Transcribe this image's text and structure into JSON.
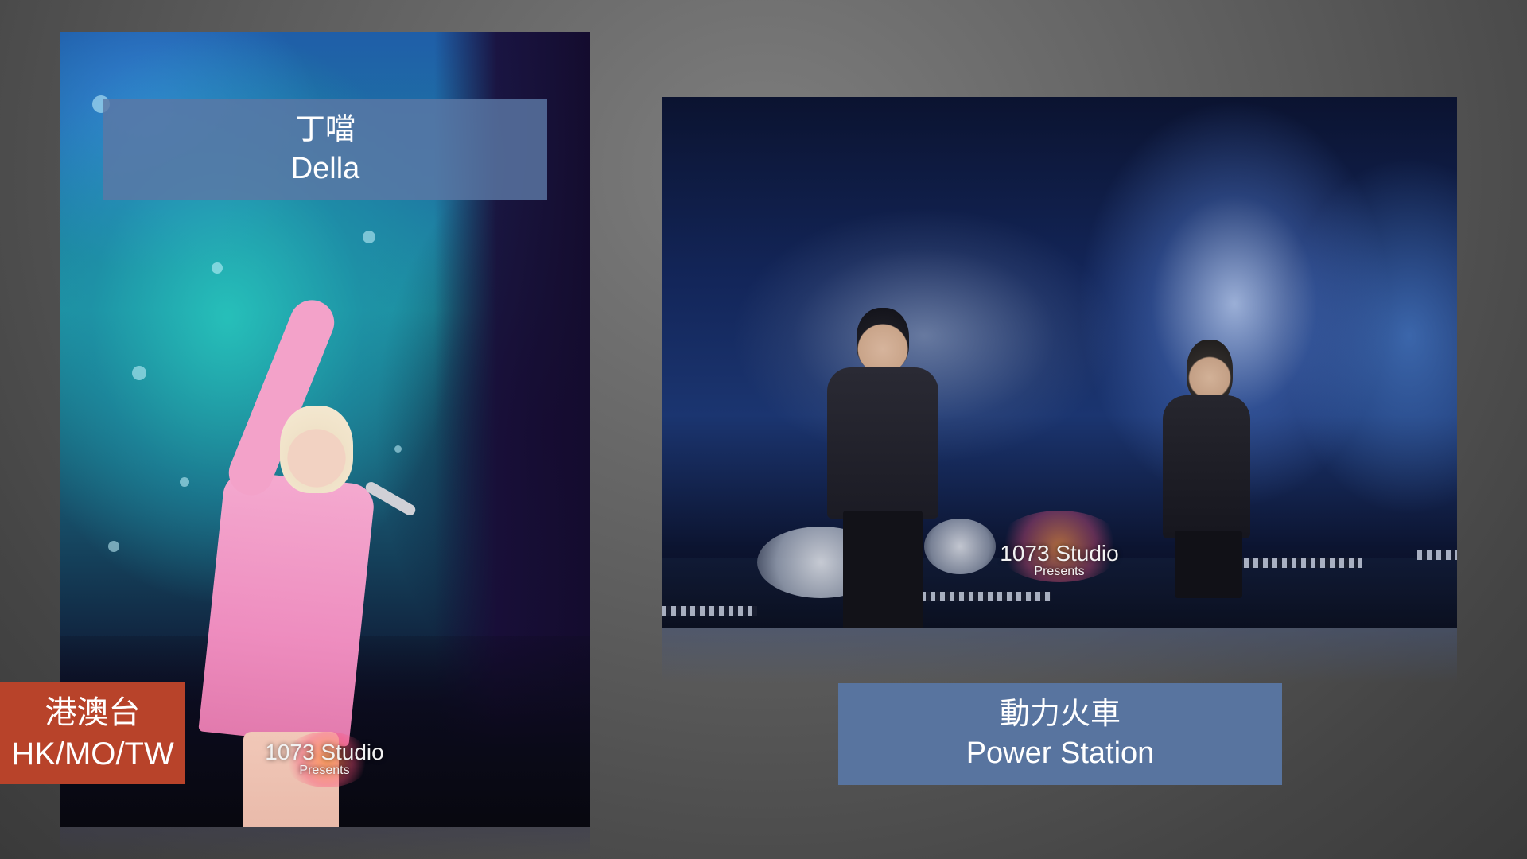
{
  "colors": {
    "background": "#5e5e5e",
    "label_blue": "#58749f",
    "label_red": "#b8432a"
  },
  "photos": {
    "left": {
      "description_icon": "performer-pink-outfit-icon",
      "watermark_title": "1073 Studio",
      "watermark_sub": "Presents"
    },
    "right": {
      "description_icon": "band-on-stage-icon",
      "watermark_title": "1073 Studio",
      "watermark_sub": "Presents"
    }
  },
  "labels": {
    "della": {
      "line1": "丁噹",
      "line2": "Della"
    },
    "power_station": {
      "line1": "動力火車",
      "line2": "Power Station"
    },
    "region": {
      "line1": "港澳台",
      "line2": "HK/MO/TW"
    }
  }
}
